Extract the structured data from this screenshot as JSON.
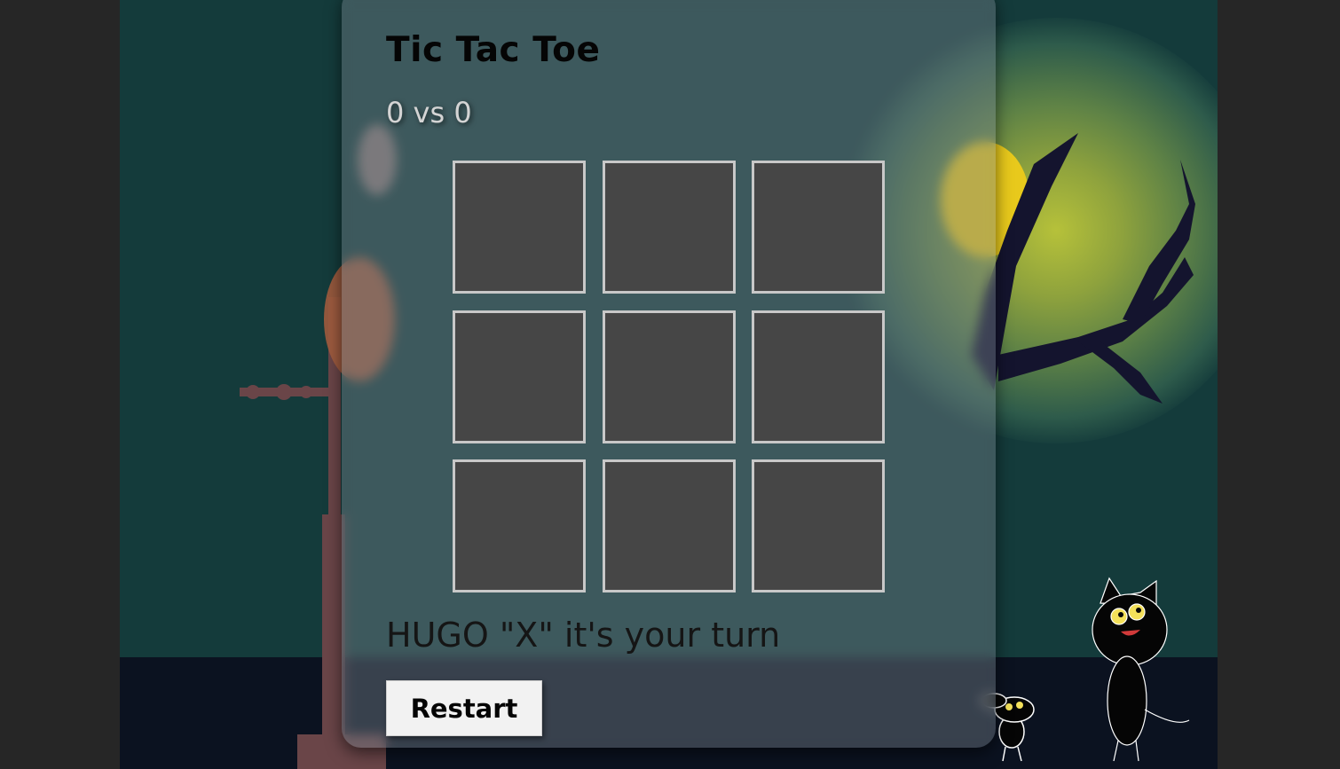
{
  "game": {
    "title": "Tic Tac Toe",
    "score": "0 vs 0",
    "status": "HUGO \"X\" it's your turn",
    "restart_label": "Restart",
    "board": [
      "",
      "",
      "",
      "",
      "",
      "",
      "",
      "",
      ""
    ]
  },
  "colors": {
    "page_bg": "#262626",
    "scene_sky": "#143b3b",
    "moon": "#e8c91c",
    "ground": "#0b1220",
    "cell_bg": "#464646",
    "cell_border": "#c8c8c8"
  }
}
